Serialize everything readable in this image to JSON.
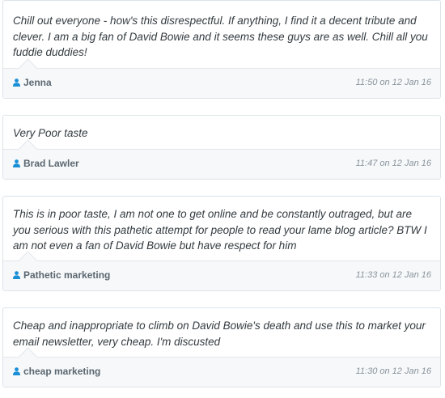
{
  "comments": [
    {
      "text": "Chill out everyone - how's this disrespectful. If anything, I find it a decent tribute and clever. I am a big fan of David Bowie and it seems these guys are as well. Chill all you fuddie duddies!",
      "author": "Jenna",
      "timestamp": "11:50 on 12 Jan 16",
      "author_icon": "user-icon"
    },
    {
      "text": "Very Poor taste",
      "author": "Brad Lawler",
      "timestamp": "11:47 on 12 Jan 16",
      "author_icon": "user-icon"
    },
    {
      "text": "This is in poor taste, I am not one to get online and be constantly outraged, but are you serious with this pathetic attempt for people to read your lame blog article? BTW I am not even a fan of David Bowie but have respect for him",
      "author": "Pathetic marketing",
      "timestamp": "11:33 on 12 Jan 16",
      "author_icon": "user-icon"
    },
    {
      "text": "Cheap and inappropriate to climb on David Bowie's death and use this to market your email newsletter, very cheap. I'm discusted",
      "author": "cheap marketing",
      "timestamp": "11:30 on 12 Jan 16",
      "author_icon": "user-icon"
    }
  ],
  "colors": {
    "icon_blue": "#1a8fd6",
    "author_text": "#5b6770",
    "timestamp_text": "#8a949c",
    "body_text": "#333b40",
    "footer_bg": "#f6f8fa",
    "border": "#dde3e8"
  }
}
